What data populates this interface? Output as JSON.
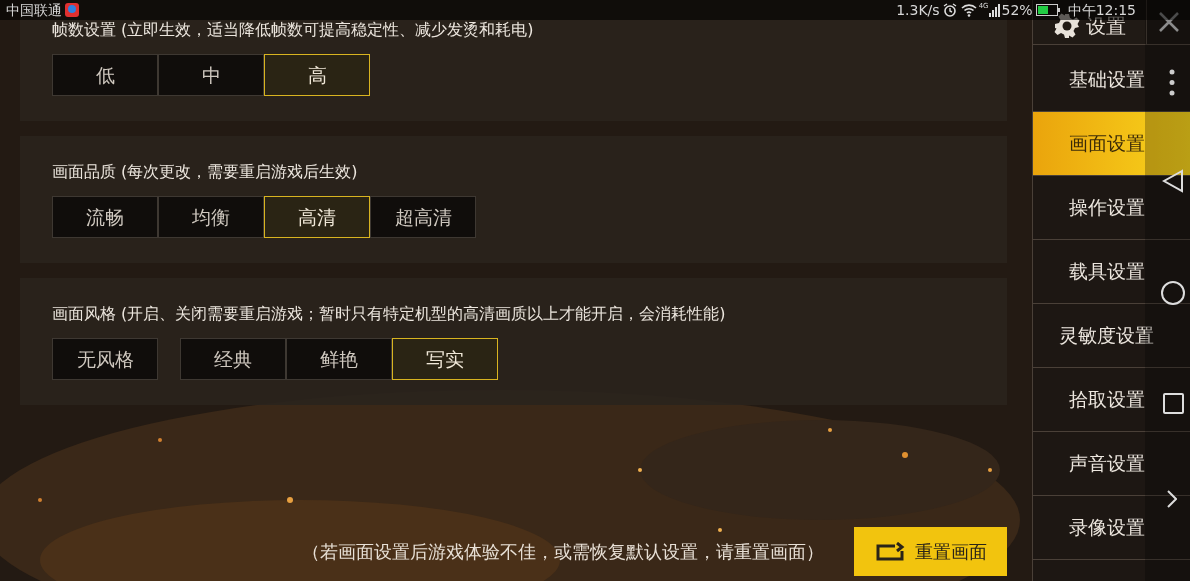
{
  "status_bar": {
    "carrier": "中国联通",
    "speed": "1.3K/s",
    "network": "4G",
    "battery": "52%",
    "time": "中午12:15"
  },
  "sections": [
    {
      "title": "帧数设置 (立即生效，适当降低帧数可提高稳定性、减少发烫和耗电)",
      "groups": [
        {
          "options": [
            {
              "label": "低",
              "selected": false
            },
            {
              "label": "中",
              "selected": false
            },
            {
              "label": "高",
              "selected": true
            }
          ]
        }
      ]
    },
    {
      "title": "画面品质 (每次更改，需要重启游戏后生效)",
      "groups": [
        {
          "options": [
            {
              "label": "流畅",
              "selected": false
            },
            {
              "label": "均衡",
              "selected": false
            },
            {
              "label": "高清",
              "selected": true
            },
            {
              "label": "超高清",
              "selected": false
            }
          ]
        }
      ]
    },
    {
      "title": "画面风格 (开启、关闭需要重启游戏；暂时只有特定机型的高清画质以上才能开启，会消耗性能)",
      "groups": [
        {
          "options": [
            {
              "label": "无风格",
              "selected": false
            }
          ]
        },
        {
          "options": [
            {
              "label": "经典",
              "selected": false
            },
            {
              "label": "鲜艳",
              "selected": false
            },
            {
              "label": "写实",
              "selected": true
            }
          ]
        }
      ]
    }
  ],
  "footer_note": "（若画面设置后游戏体验不佳，或需恢复默认设置，请重置画面）",
  "reset_button": "重置画面",
  "sidebar": {
    "title": "设置",
    "items": [
      {
        "label": "基础设置",
        "selected": false
      },
      {
        "label": "画面设置",
        "selected": true
      },
      {
        "label": "操作设置",
        "selected": false
      },
      {
        "label": "载具设置",
        "selected": false
      },
      {
        "label": "灵敏度设置",
        "selected": false
      },
      {
        "label": "拾取设置",
        "selected": false
      },
      {
        "label": "声音设置",
        "selected": false
      },
      {
        "label": "录像设置",
        "selected": false
      }
    ]
  }
}
